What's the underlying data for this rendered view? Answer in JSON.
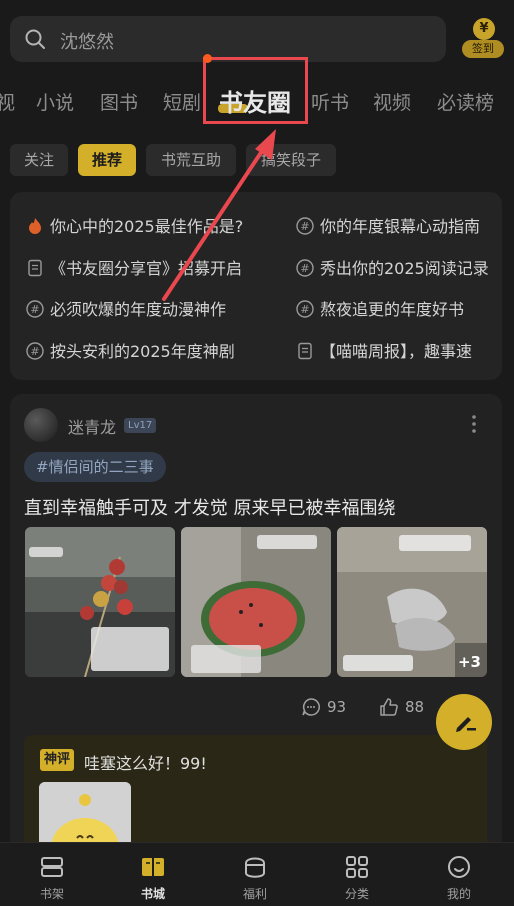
{
  "search": {
    "placeholder": "沈悠然"
  },
  "signin": {
    "coin_symbol": "¥",
    "label": "签到"
  },
  "tabs": [
    {
      "label": "视"
    },
    {
      "label": "小说"
    },
    {
      "label": "图书"
    },
    {
      "label": "短剧"
    },
    {
      "label": "书友圈",
      "active": true
    },
    {
      "label": "听书"
    },
    {
      "label": "视频"
    },
    {
      "label": "必读榜"
    }
  ],
  "chips": [
    {
      "label": "关注"
    },
    {
      "label": "推荐",
      "active": true
    },
    {
      "label": "书荒互助"
    },
    {
      "label": "搞笑段子"
    }
  ],
  "topics": [
    {
      "icon": "fire-icon",
      "text": "你心中的2025最佳作品是?"
    },
    {
      "icon": "hashtag-icon",
      "text": "你的年度银幕心动指南"
    },
    {
      "icon": "document-icon",
      "text": "《书友圈分享官》招募开启"
    },
    {
      "icon": "hashtag-icon",
      "text": "秀出你的2025阅读记录"
    },
    {
      "icon": "hashtag-icon",
      "text": "必须吹爆的年度动漫神作"
    },
    {
      "icon": "hashtag-icon",
      "text": "熬夜追更的年度好书"
    },
    {
      "icon": "hashtag-icon",
      "text": "按头安利的2025年度神剧"
    },
    {
      "icon": "document-icon",
      "text": "【喵喵周报】，趣事速"
    }
  ],
  "post": {
    "username": "迷青龙",
    "level": "Lv17",
    "tag": "#情侣间的二三事",
    "text": "直到幸福触手可及 才发觉 原来早已被幸福围绕",
    "more_images": "+3",
    "comments": "93",
    "likes": "88"
  },
  "comment": {
    "badge": "神评",
    "text": "哇塞这么好！99!"
  },
  "bottom_nav": [
    {
      "label": "书架"
    },
    {
      "label": "书城",
      "active": true
    },
    {
      "label": "福利"
    },
    {
      "label": "分类"
    },
    {
      "label": "我的"
    }
  ],
  "colors": {
    "accent": "#d4af2a",
    "background": "#1a1a1a",
    "highlight_box": "#e8484e"
  }
}
